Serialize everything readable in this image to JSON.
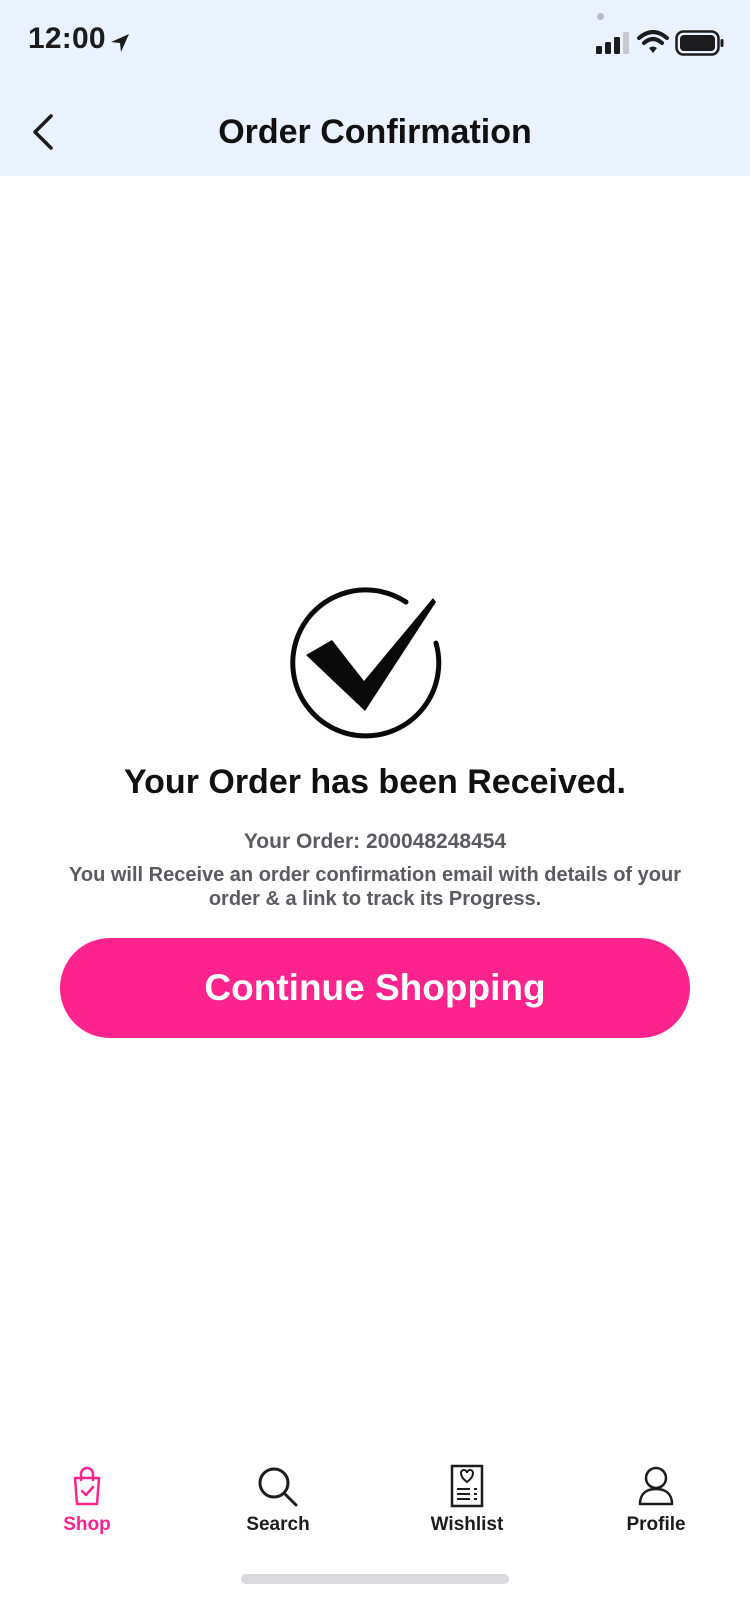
{
  "status_bar": {
    "time": "12:00",
    "icons": [
      "location-arrow-icon",
      "signal-icon",
      "wifi-icon",
      "battery-icon"
    ]
  },
  "header": {
    "title": "Order Confirmation",
    "back_icon": "chevron-left-icon"
  },
  "confirmation": {
    "icon": "check-circle-icon",
    "headline": "Your Order has been Received.",
    "order_number": "Your Order: 200048248454",
    "info": "You will Receive an order confirmation email with details of your order & a link to track its Progress.",
    "button_label": "Continue Shopping"
  },
  "tab_bar": {
    "items": [
      {
        "label": "Shop",
        "icon": "shopping-bag-icon",
        "active": true
      },
      {
        "label": "Search",
        "icon": "search-icon",
        "active": false
      },
      {
        "label": "Wishlist",
        "icon": "wishlist-icon",
        "active": false
      },
      {
        "label": "Profile",
        "icon": "profile-icon",
        "active": false
      }
    ]
  },
  "colors": {
    "accent": "#ff238d",
    "header_bg": "#eaf2ff",
    "text_primary": "#111111",
    "text_secondary": "#5a5a60"
  }
}
